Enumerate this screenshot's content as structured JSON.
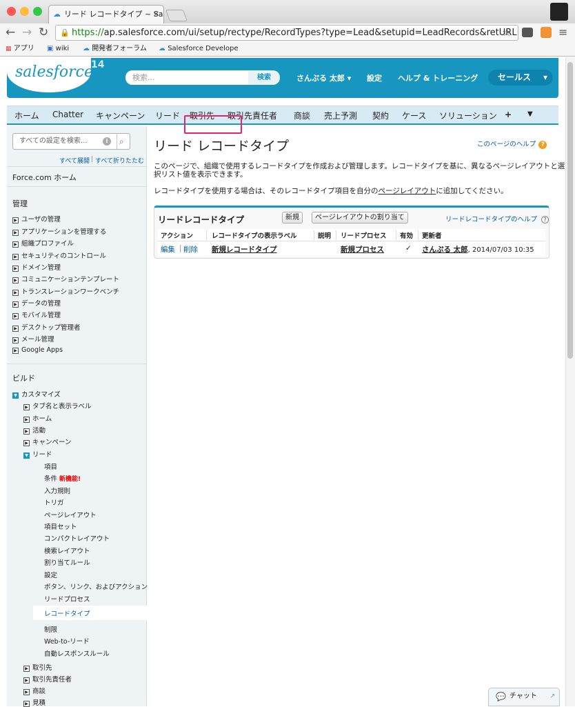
{
  "browser": {
    "tab_title": "リード レコードタイプ ~ Sal",
    "url_proto": "https://",
    "url_rest": "ap.salesforce.com/ui/setup/rectype/RecordTypes?type=Lead&setupid=LeadRecords&retURL=...",
    "bookmarks": [
      "アプリ",
      "wiki",
      "開発者フォーラム",
      "Salesforce Develope"
    ]
  },
  "header": {
    "logo": "salesforce",
    "version": "14",
    "search_placeholder": "検索...",
    "search_button": "検索",
    "user": "さんぷる 太郎",
    "setup": "設定",
    "help": "ヘルプ & トレーニング",
    "app": "セールス"
  },
  "tabs": [
    "ホーム",
    "Chatter",
    "キャンペーン",
    "リード",
    "取引先",
    "取引先責任者",
    "商談",
    "売上予測",
    "契約",
    "ケース",
    "ソリューション",
    "+"
  ],
  "sidebar": {
    "search_placeholder": "すべての設定を検索...",
    "expand_all": "すべて展開",
    "sep": "|",
    "collapse_all": "すべて折りたたむ",
    "home": "Force.com ホーム",
    "admin_title": "管理",
    "admin_items": [
      "ユーザの管理",
      "アプリケーションを管理する",
      "組織プロファイル",
      "セキュリティのコントロール",
      "ドメイン管理",
      "コミュニケーションテンプレート",
      "トランスレーションワークベンチ",
      "データの管理",
      "モバイル管理",
      "デスクトップ管理者",
      "メール管理",
      "Google Apps"
    ],
    "build_title": "ビルド",
    "customize": "カスタマイズ",
    "customize_items": [
      "タブ名と表示ラベル",
      "ホーム",
      "活動",
      "キャンペーン"
    ],
    "lead": "リード",
    "lead_items": [
      "項目",
      "条件",
      "入力規則",
      "トリガ",
      "ページレイアウト",
      "項目セット",
      "コンパクトレイアウト",
      "検索レイアウト",
      "割り当てルール",
      "設定",
      "ボタン、リンク、およびアクション",
      "リードプロセス",
      "レコードタイプ",
      "制限",
      "Web-to-リード",
      "自動レスポンスルール"
    ],
    "new_feature": "新機能!",
    "after_items": [
      "取引先",
      "取引先責任者",
      "商談",
      "見積"
    ]
  },
  "main": {
    "title": "リード レコードタイプ",
    "page_help": "このページのヘルプ",
    "desc1": "このページで、組織で使用するレコードタイプを作成および管理します。レコードタイプを基に、異なるページレイアウトと選択リスト値を表示できます。",
    "desc2_pre": "レコードタイプを使用する場合は、そのレコードタイプ項目を自分の",
    "desc2_link": "ページレイアウト",
    "desc2_post": "に追加してください。",
    "panel_title": "リードレコードタイプ",
    "new_button": "新規",
    "assign_button": "ページレイアウトの割り当て",
    "panel_help": "リードレコードタイプのヘルプ",
    "columns": [
      "アクション",
      "レコードタイプの表示ラベル",
      "説明",
      "リードプロセス",
      "有効",
      "更新者"
    ],
    "row": {
      "edit": "編集",
      "sep": "|",
      "delete": "削除",
      "label": "新規レコードタイプ",
      "description": "",
      "process": "新規プロセス",
      "active": "✓",
      "updated_by": "さんぷる 太郎",
      "updated_at": ", 2014/07/03 10:35"
    }
  },
  "chat": "チャット"
}
